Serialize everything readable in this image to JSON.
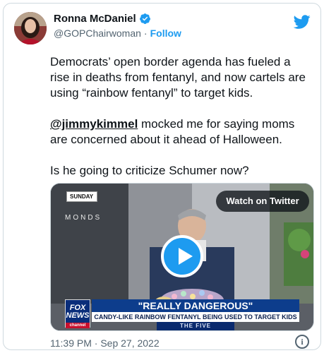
{
  "author": {
    "display_name": "Ronna McDaniel",
    "handle": "@GOPChairwoman",
    "separator": "·",
    "follow_label": "Follow"
  },
  "tweet": {
    "paragraph1": "Democrats’ open border agenda has fueled a rise in deaths from fentanyl, and now cartels are using “rainbow fentanyl” to target kids.",
    "mention": "@jimmykimmel",
    "paragraph2_rest": " mocked me for saying moms are concerned about it ahead of Halloween.",
    "paragraph3": "Is he going to criticize Schumer now?"
  },
  "media": {
    "watch_label": "Watch on Twitter",
    "show_tag": "SUNDAY",
    "backdrop_text": "MONDS",
    "network_logo": "FOX NEWS",
    "network_sub": "channel",
    "headline": "\"REALLY DANGEROUS\"",
    "subheadline": "CANDY-LIKE RAINBOW FENTANYL BEING USED TO TARGET KIDS",
    "show_name": "THE FIVE"
  },
  "footer": {
    "timestamp": "11:39 PM · Sep 27, 2022"
  },
  "icons": {
    "verified": "verified-badge-icon",
    "brand": "twitter-bird-icon",
    "play": "play-icon",
    "info": "info-icon"
  },
  "colors": {
    "accent": "#1d9bf0",
    "text": "#0f1419",
    "muted": "#536471",
    "fox_blue": "#0d3d8c"
  }
}
